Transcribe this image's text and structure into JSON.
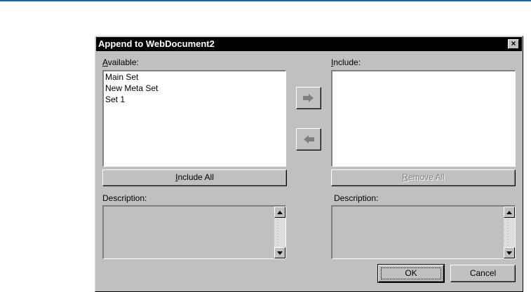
{
  "dialog": {
    "title": "Append to WebDocument2",
    "close_glyph": "×"
  },
  "available": {
    "label_prefix": "",
    "label_underline": "A",
    "label_rest": "vailable:",
    "items": [
      "Main Set",
      "New Meta Set",
      "Set 1"
    ]
  },
  "include": {
    "label_prefix": "",
    "label_underline": "I",
    "label_rest": "nclude:",
    "items": []
  },
  "buttons": {
    "include_all_prefix": "",
    "include_all_underline": "I",
    "include_all_rest": "nclude All",
    "remove_all_prefix": "",
    "remove_all_underline": "R",
    "remove_all_rest": "emove All",
    "ok": "OK",
    "cancel": "Cancel"
  },
  "descriptions": {
    "left_label": "Description:",
    "right_label": "Description:"
  },
  "icons": {
    "move_right": "arrow-right-icon",
    "move_left": "arrow-left-icon",
    "scroll_up": "triangle-up-icon",
    "scroll_down": "triangle-down-icon"
  },
  "colors": {
    "title_bar": "#000000",
    "dialog_face": "#c0c0c0",
    "accent_rule": "#1d66ad"
  }
}
